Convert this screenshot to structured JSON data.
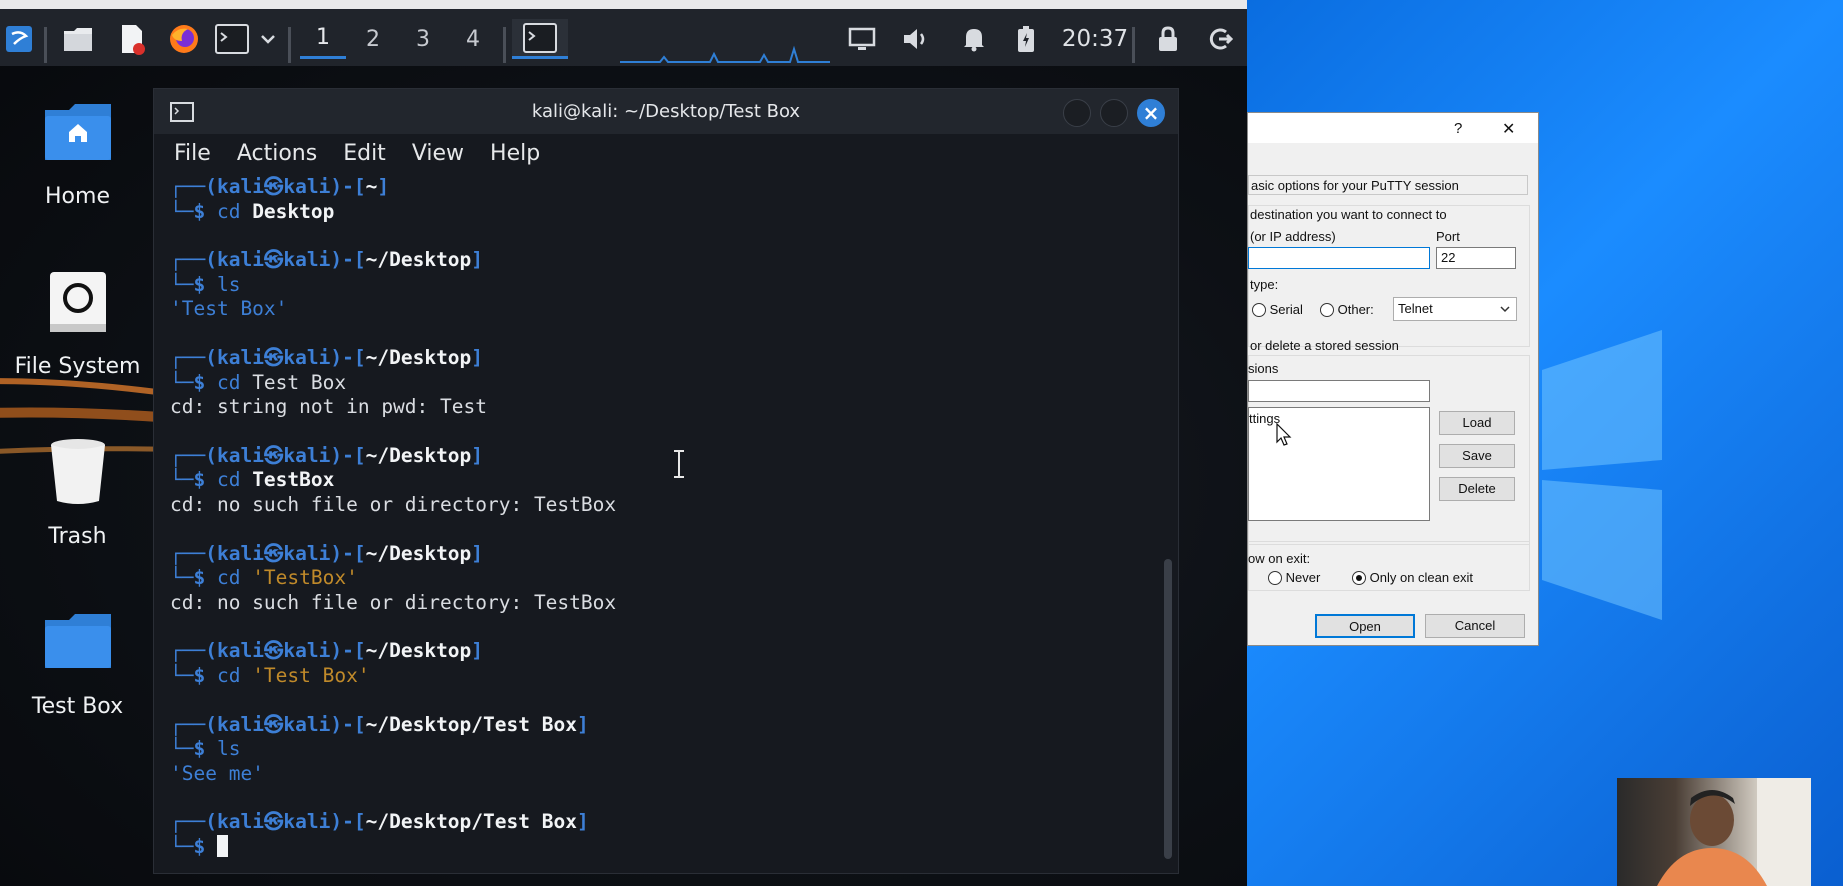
{
  "taskbar": {
    "workspaces": [
      "1",
      "2",
      "3",
      "4"
    ],
    "clock": "20:37"
  },
  "desktop": {
    "icons": [
      {
        "label": "Home"
      },
      {
        "label": "File System"
      },
      {
        "label": "Trash"
      },
      {
        "label": "Test Box"
      }
    ]
  },
  "terminal": {
    "title": "kali@kali: ~/Desktop/Test Box",
    "menu": [
      "File",
      "Actions",
      "Edit",
      "View",
      "Help"
    ],
    "user": "kali",
    "host": "kali",
    "blocks": [
      {
        "path": "~",
        "cmd": "cd",
        "arg": "Desktop",
        "output": ""
      },
      {
        "path": "~/Desktop",
        "cmd": "ls",
        "arg": "",
        "output": "'Test Box'"
      },
      {
        "path": "~/Desktop",
        "cmd": "cd",
        "arg": "Test Box",
        "output": "cd: string not in pwd: Test"
      },
      {
        "path": "~/Desktop",
        "cmd": "cd",
        "arg": "TestBox",
        "output": "cd: no such file or directory: TestBox"
      },
      {
        "path": "~/Desktop",
        "cmd": "cd",
        "arg": "'TestBox'",
        "output": "cd: no such file or directory: TestBox"
      },
      {
        "path": "~/Desktop",
        "cmd": "cd",
        "arg": "'Test Box'",
        "output": ""
      },
      {
        "path": "~/Desktop/Test Box",
        "cmd": "ls",
        "arg": "",
        "output": "'See me'"
      },
      {
        "path": "~/Desktop/Test Box",
        "cmd": "",
        "arg": "",
        "output": ""
      }
    ]
  },
  "putty": {
    "help_label": "?",
    "close_label": "✕",
    "section_title": "asic options for your PuTTY session",
    "destination_label": "destination you want to connect to",
    "host_label": "(or IP address)",
    "port_label": "Port",
    "port_value": "22",
    "conn_type_label": "type:",
    "serial_label": "Serial",
    "other_label": "Other:",
    "other_value": "Telnet",
    "sessions_group_label": "or delete a stored session",
    "saved_sessions_label": "sions",
    "session_list_item": "ttings",
    "load_label": "Load",
    "save_label": "Save",
    "delete_label": "Delete",
    "close_window_label": "ow on exit:",
    "never_label": "Never",
    "clean_exit_label": "Only on clean exit",
    "open_label": "Open",
    "cancel_label": "Cancel"
  }
}
